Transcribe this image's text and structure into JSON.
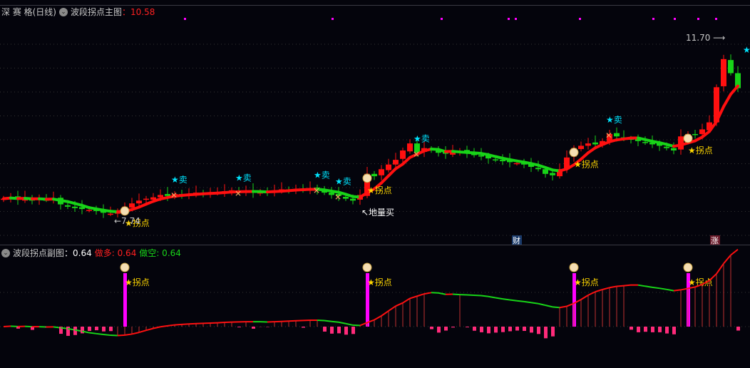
{
  "main_header": {
    "stock": "深 赛 格(日线)",
    "indicator": "波段拐点主图",
    "sep": "：",
    "value": "10.58"
  },
  "sub_header": {
    "indicator": "波段拐点副图",
    "value_label": "：0.64",
    "long_label": "做多: 0.64",
    "short_label": "做空: 0.64"
  },
  "colors": {
    "up": "#ff1010",
    "down": "#18d418",
    "sell": "#00e5ff",
    "turn": "#ffd700",
    "magenta": "#ff00ff",
    "pink": "#ff2a7a"
  },
  "chart_data": {
    "type": "candlestick",
    "price_range": [
      7.55,
      12.3
    ],
    "closes": [
      8.22,
      8.25,
      8.2,
      8.24,
      8.18,
      8.22,
      8.2,
      8.22,
      8.1,
      8.05,
      8.02,
      8.0,
      7.98,
      7.96,
      7.92,
      7.9,
      7.95,
      8.05,
      8.12,
      8.18,
      8.22,
      8.25,
      8.3,
      8.28,
      8.32,
      8.3,
      8.32,
      8.35,
      8.33,
      8.36,
      8.34,
      8.38,
      8.4,
      8.36,
      8.38,
      8.35,
      8.37,
      8.36,
      8.4,
      8.42,
      8.41,
      8.43,
      8.4,
      8.44,
      8.42,
      8.35,
      8.3,
      8.28,
      8.22,
      8.18,
      8.3,
      8.75,
      8.7,
      8.85,
      8.95,
      9.05,
      9.25,
      9.4,
      9.2,
      9.3,
      9.25,
      9.2,
      9.18,
      9.22,
      9.24,
      9.2,
      9.15,
      9.12,
      9.08,
      9.05,
      9.02,
      9.0,
      8.98,
      8.95,
      8.9,
      8.85,
      8.75,
      8.72,
      8.85,
      9.1,
      9.3,
      9.35,
      9.4,
      9.38,
      9.45,
      9.6,
      9.55,
      9.5,
      9.48,
      9.45,
      9.42,
      9.38,
      9.35,
      9.3,
      9.25,
      9.55,
      9.6,
      9.58,
      9.7,
      9.85,
      10.6,
      11.2,
      10.9,
      10.58
    ],
    "sell_signals": {
      "label": "★卖",
      "indices": [
        24,
        33,
        44,
        47,
        58,
        85
      ]
    },
    "turn_points": {
      "label": "★拐点",
      "indices": [
        17,
        51,
        80,
        96
      ]
    },
    "low_marker": {
      "text": "←7.74",
      "index": 15,
      "price": 7.74
    },
    "high_marker": {
      "text": "11.70",
      "index": 101,
      "price": 11.7
    },
    "ground_volume_buy": {
      "text": "↖地量买",
      "index": 51
    },
    "badges": [
      {
        "text": "财",
        "index": 72
      },
      {
        "text": "涨",
        "index": 99
      }
    ]
  }
}
